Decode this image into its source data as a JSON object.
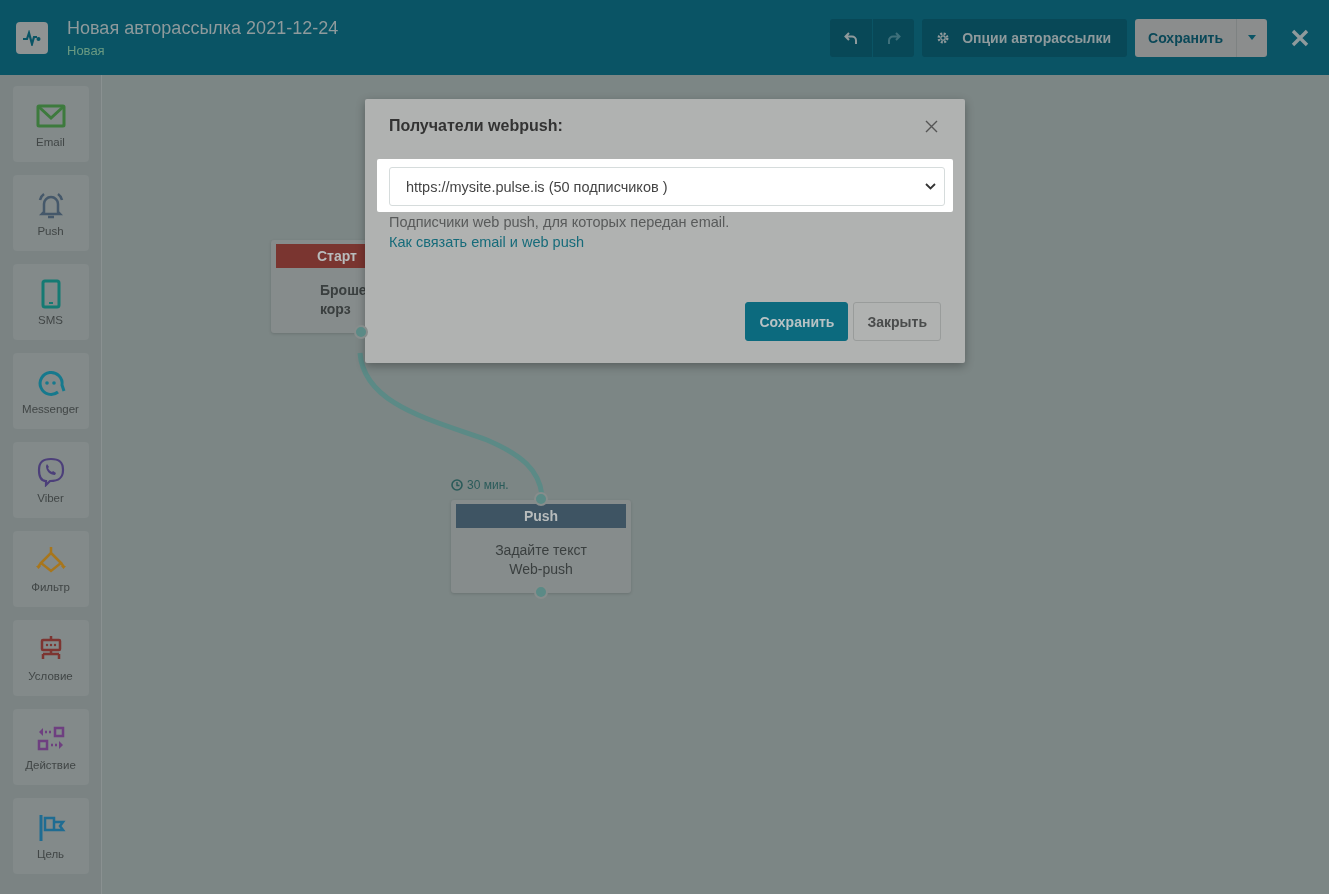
{
  "header": {
    "title": "Новая авторассылка 2021-12-24",
    "status": "Новая",
    "history": [
      {
        "kind": "undo",
        "disabled": false
      },
      {
        "kind": "redo",
        "disabled": true
      }
    ],
    "options_button": "Опции авторассылки",
    "save_button": "Сохранить"
  },
  "sidebar": {
    "items": [
      {
        "kind": "email",
        "label": "Email"
      },
      {
        "kind": "push",
        "label": "Push"
      },
      {
        "kind": "sms",
        "label": "SMS"
      },
      {
        "kind": "messenger",
        "label": "Messenger"
      },
      {
        "kind": "viber",
        "label": "Viber"
      },
      {
        "kind": "filter",
        "label": "Фильтр"
      },
      {
        "kind": "condition",
        "label": "Условие"
      },
      {
        "kind": "action",
        "label": "Действие"
      },
      {
        "kind": "goal",
        "label": "Цель"
      }
    ]
  },
  "canvas": {
    "nodes": [
      {
        "kind": "start",
        "header": "Старт",
        "lines": [
          "Броше",
          "корз"
        ]
      },
      {
        "kind": "push",
        "delay": "30 мин.",
        "header": "Push",
        "lines": [
          "Задайте текст",
          "Web-push"
        ]
      }
    ]
  },
  "dialog": {
    "title": "Получатели webpush:",
    "select": {
      "value": "https://mysite.pulse.is (50 подписчиков )"
    },
    "hint": "Подписчики web push, для которых передан email.",
    "link": "Как связать email и web push",
    "buttons": [
      {
        "kind": "primary",
        "label": "Сохранить"
      },
      {
        "kind": "default",
        "label": "Закрыть"
      }
    ]
  }
}
